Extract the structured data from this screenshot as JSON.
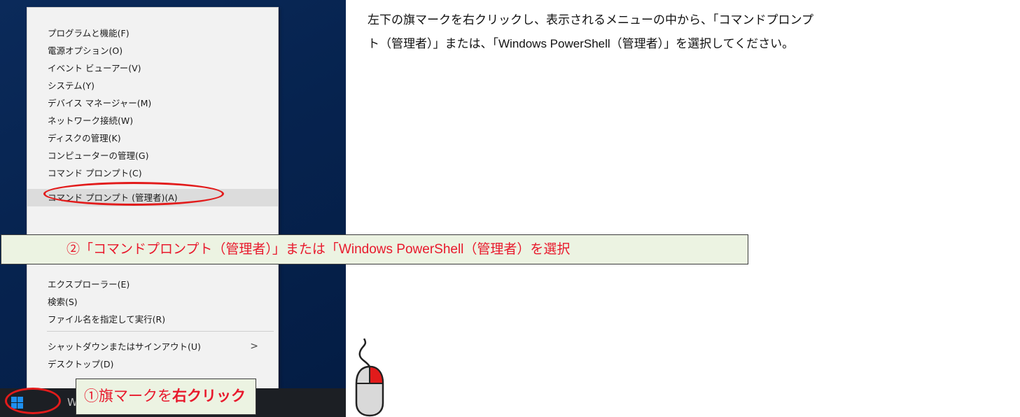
{
  "instruction": {
    "line1": "左下の旗マークを右クリックし、表示されるメニューの中から、「コマンドプロンプ",
    "line2": "ト（管理者）」または、「Windows PowerShell（管理者）」を選択してください。"
  },
  "context_menu": {
    "items": [
      {
        "label": "プログラムと機能(F)"
      },
      {
        "label": "電源オプション(O)"
      },
      {
        "label": "イベント ビューアー(V)"
      },
      {
        "label": "システム(Y)"
      },
      {
        "label": "デバイス マネージャー(M)"
      },
      {
        "label": "ネットワーク接続(W)"
      },
      {
        "label": "ディスクの管理(K)"
      },
      {
        "label": "コンピューターの管理(G)"
      },
      {
        "label": "コマンド プロンプト(C)"
      },
      {
        "label": "コマンド プロンプト (管理者)(A)"
      },
      {
        "label": "エクスプローラー(E)"
      },
      {
        "label": "検索(S)"
      },
      {
        "label": "ファイル名を指定して実行(R)"
      },
      {
        "label": "シャットダウンまたはサインアウト(U)",
        "submenu_arrow": ">"
      },
      {
        "label": "デスクトップ(D)"
      }
    ]
  },
  "callouts": {
    "step2_prefix": "②「コマンドプロンプト（管理者）」または「Windows PowerShell（管理者）を選択",
    "step1_prefix": "①旗マークを",
    "step1_emphasis": "右クリック"
  },
  "taskbar": {
    "search_letter": "W"
  },
  "icons": {
    "start": "windows-logo-icon",
    "mouse": "mouse-right-click-icon"
  },
  "colors": {
    "highlight_red": "#e21b1b",
    "callout_bg": "#ecf3e2",
    "callout_text": "#e8192c",
    "desktop_blue": "#06234f",
    "win_logo_blue": "#1d8ff0"
  }
}
